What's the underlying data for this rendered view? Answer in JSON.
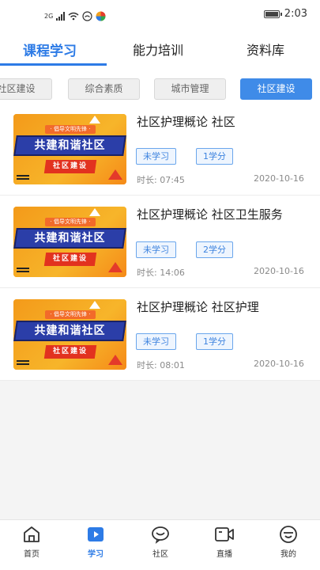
{
  "status_bar": {
    "network": "2G",
    "time": "2:03"
  },
  "top_tabs": [
    {
      "label": "课程学习",
      "active": true
    },
    {
      "label": "能力培训",
      "active": false
    },
    {
      "label": "资料库",
      "active": false
    }
  ],
  "sub_tabs": [
    {
      "label": "社区建设",
      "active": false
    },
    {
      "label": "综合素质",
      "active": false
    },
    {
      "label": "城市管理",
      "active": false
    },
    {
      "label": "社区建设",
      "active": true
    }
  ],
  "thumbnail": {
    "slogan": "· 倡导文明先锋 ·",
    "title": "共建和谐社区",
    "subtitle": "社区建设"
  },
  "courses": [
    {
      "title": "社区护理概论 社区",
      "status": "未学习",
      "credit": "1学分",
      "duration": "时长: 07:45",
      "date": "2020-10-16"
    },
    {
      "title": "社区护理概论 社区卫生服务",
      "status": "未学习",
      "credit": "2学分",
      "duration": "时长: 14:06",
      "date": "2020-10-16"
    },
    {
      "title": "社区护理概论 社区护理",
      "status": "未学习",
      "credit": "1学分",
      "duration": "时长: 08:01",
      "date": "2020-10-16"
    }
  ],
  "bottom_nav": [
    {
      "label": "首页",
      "icon": "home-icon",
      "active": false
    },
    {
      "label": "学习",
      "icon": "play-icon",
      "active": true
    },
    {
      "label": "社区",
      "icon": "chat-icon",
      "active": false
    },
    {
      "label": "直播",
      "icon": "video-icon",
      "active": false
    },
    {
      "label": "我的",
      "icon": "smile-icon",
      "active": false
    }
  ],
  "colors": {
    "accent": "#2d7be6",
    "chip_active": "#3f8be8",
    "tag_border": "#6aa6ec"
  }
}
